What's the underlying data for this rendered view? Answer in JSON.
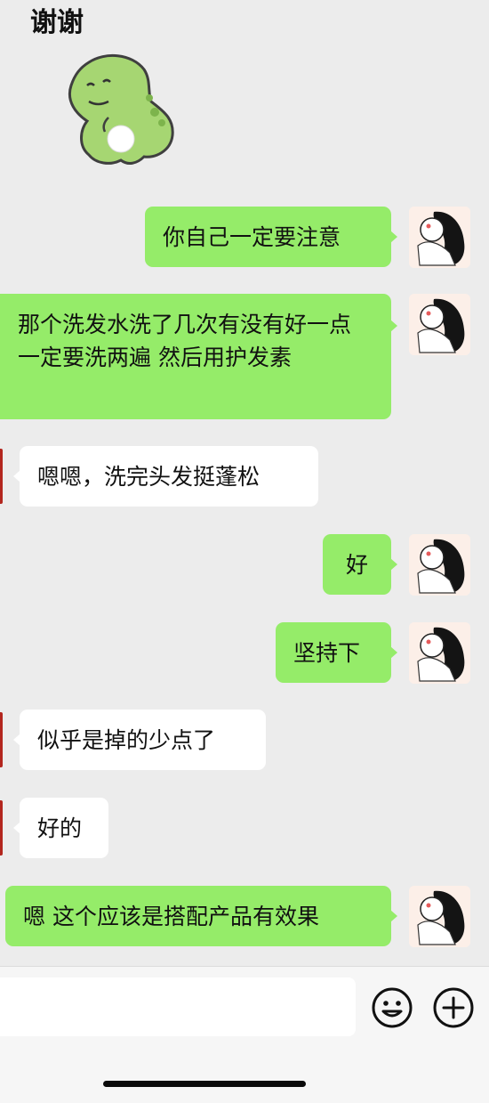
{
  "chat": {
    "top_message": "谢谢",
    "messages": [
      {
        "side": "out",
        "text": "你自己一定要注意"
      },
      {
        "side": "out",
        "text": "那个洗发水洗了几次有没有好一点 一定要洗两遍 然后用护发素"
      },
      {
        "side": "in",
        "text": "嗯嗯，洗完头发挺蓬松"
      },
      {
        "side": "out",
        "text": "好"
      },
      {
        "side": "out",
        "text": "坚持下"
      },
      {
        "side": "in",
        "text": "似乎是掉的少点了"
      },
      {
        "side": "in",
        "text": "好的"
      },
      {
        "side": "out",
        "text": "嗯 这个应该是搭配产品有效果"
      }
    ]
  },
  "sticker": {
    "icon": "dinosaur-sticker"
  },
  "toolbar": {
    "input_value": "",
    "emoji_icon": "emoji-icon",
    "more_icon": "plus-icon"
  },
  "colors": {
    "background": "#ececec",
    "outgoing_bubble": "#95ec69",
    "incoming_bubble": "#ffffff",
    "toolbar": "#f6f6f6"
  }
}
